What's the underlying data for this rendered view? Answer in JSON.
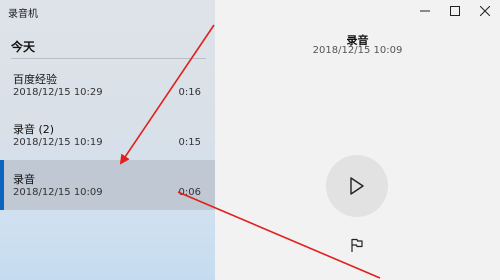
{
  "app": {
    "title": "录音机"
  },
  "sidebar": {
    "section": "今天",
    "recordings": [
      {
        "name": "百度经验",
        "date": "2018/12/15 10:29",
        "duration": "0:16",
        "selected": false
      },
      {
        "name": "录音 (2)",
        "date": "2018/12/15 10:19",
        "duration": "0:15",
        "selected": false
      },
      {
        "name": "录音",
        "date": "2018/12/15 10:09",
        "duration": "0:06",
        "selected": true
      }
    ]
  },
  "detail": {
    "title": "录音",
    "date": "2018/12/15 10:09"
  },
  "icons": {
    "minimize": "minimize-icon",
    "maximize": "maximize-icon",
    "close": "close-icon",
    "play": "play-icon",
    "flag": "flag-icon"
  },
  "colors": {
    "accent": "#0a64c0",
    "annotation": "#e0201c"
  }
}
